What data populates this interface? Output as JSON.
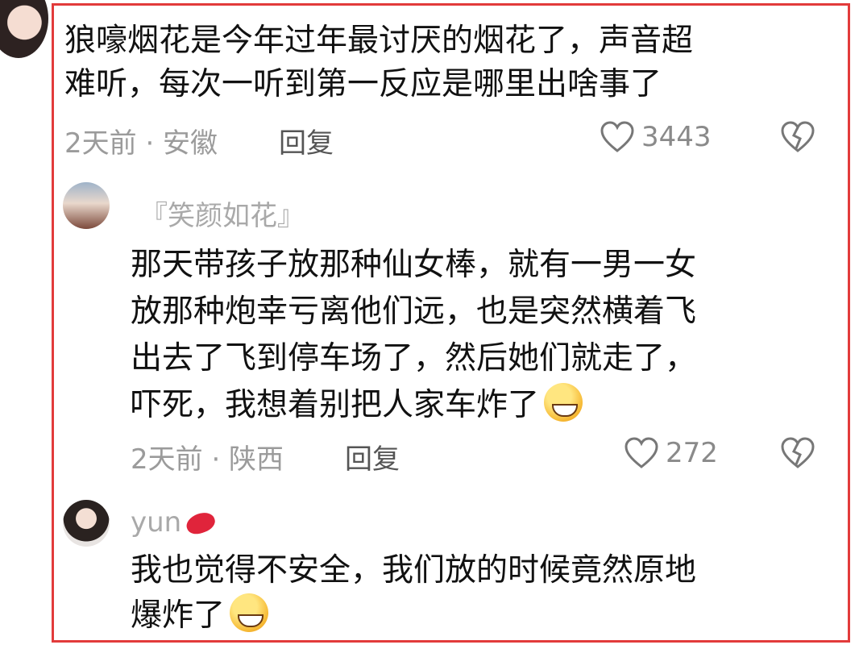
{
  "comment1": {
    "lines": [
      "狼嚎烟花是今年过年最讨厌的烟花了，声音超",
      "难听，每次一听到第一反应是哪里出啥事了"
    ],
    "meta": "2天前 · 安徽",
    "reply": "回复",
    "likes": "3443"
  },
  "comment2": {
    "user": "『笑颜如花』",
    "lines": [
      "那天带孩子放那种仙女棒，就有一男一女",
      "放那种炮幸亏离他们远，也是突然横着飞",
      "出去了飞到停车场了，然后她们就走了，",
      "吓死，我想着别把人家车炸了"
    ],
    "meta": "2天前 · 陕西",
    "reply": "回复",
    "likes": "272"
  },
  "comment3": {
    "user": "yun",
    "lines": [
      "我也觉得不安全，我们放的时候竟然原地",
      "爆炸了"
    ]
  },
  "colors": {
    "frame": "#e23b3b",
    "meta": "#9b9b9b",
    "text": "#111111"
  },
  "icons": [
    "heart-outline-icon",
    "broken-heart-icon",
    "grin-sweat-emoji",
    "lips-emoji",
    "laugh-tears-emoji"
  ]
}
